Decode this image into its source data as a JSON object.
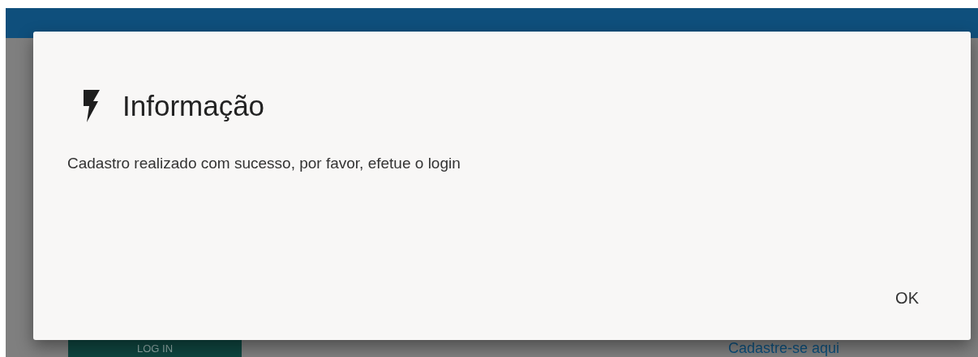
{
  "dialog": {
    "title": "Informação",
    "message": "Cadastro realizado com sucesso, por favor, efetue o login",
    "buttons": [
      "OK"
    ]
  },
  "page": {
    "login_button": "LOG IN",
    "register_link": "Cadastre-se aqui"
  }
}
